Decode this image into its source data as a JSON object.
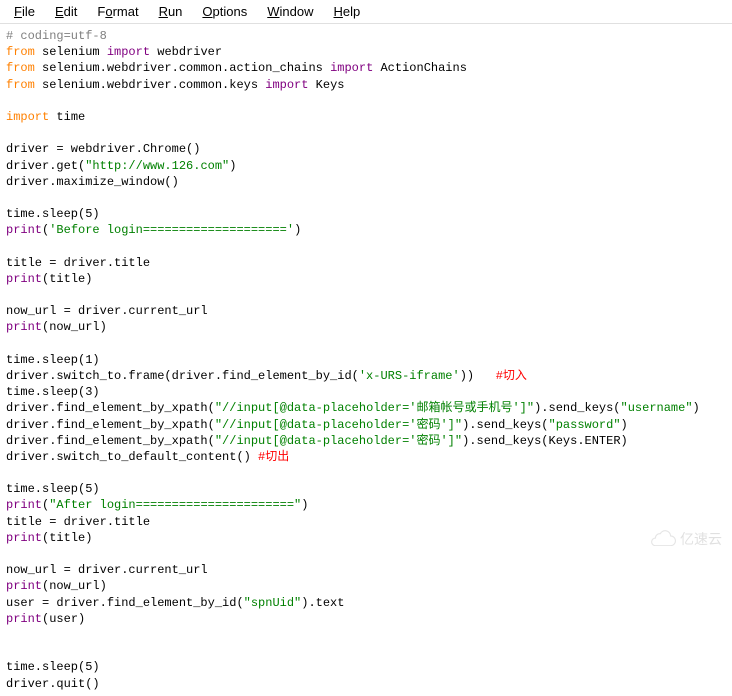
{
  "menu": {
    "file": "File",
    "edit": "Edit",
    "format": "Format",
    "run": "Run",
    "options": "Options",
    "window": "Window",
    "help": "Help"
  },
  "code": {
    "l1_comment": "# coding=utf-8",
    "l2_from": "from",
    "l2_mod": " selenium ",
    "l2_import": "import",
    "l2_item": " webdriver",
    "l3_from": "from",
    "l3_mod": " selenium.webdriver.common.action_chains ",
    "l3_import": "import",
    "l3_item": " ActionChains",
    "l4_from": "from",
    "l4_mod": " selenium.webdriver.common.keys ",
    "l4_import": "import",
    "l4_item": " Keys",
    "l6_import": "import",
    "l6_item": " time",
    "l8": "driver = webdriver.Chrome()",
    "l9a": "driver.get(",
    "l9s": "\"http://www.126.com\"",
    "l9b": ")",
    "l10": "driver.maximize_window()",
    "l12": "time.sleep(5)",
    "l13p": "print",
    "l13a": "(",
    "l13s": "'Before login===================='",
    "l13b": ")",
    "l15": "title = driver.title",
    "l16p": "print",
    "l16a": "(title)",
    "l18": "now_url = driver.current_url",
    "l19p": "print",
    "l19a": "(now_url)",
    "l21": "time.sleep(1)",
    "l22a": "driver.switch_to.frame(driver.find_element_by_id(",
    "l22s": "'x-URS-iframe'",
    "l22b": "))   ",
    "l22c": "#切入",
    "l23": "time.sleep(3)",
    "l24a": "driver.find_element_by_xpath(",
    "l24s": "\"//input[@data-placeholder='邮箱帐号或手机号']\"",
    "l24b": ").send_keys(",
    "l24s2": "\"username\"",
    "l24c": ")",
    "l25a": "driver.find_element_by_xpath(",
    "l25s": "\"//input[@data-placeholder='密码']\"",
    "l25b": ").send_keys(",
    "l25s2": "\"password\"",
    "l25c": ")",
    "l26a": "driver.find_element_by_xpath(",
    "l26s": "\"//input[@data-placeholder='密码']\"",
    "l26b": ").send_keys(Keys.ENTER)",
    "l27a": "driver.switch_to_default_content() ",
    "l27c": "#切出",
    "l29": "time.sleep(5)",
    "l30p": "print",
    "l30a": "(",
    "l30s": "\"After login======================\"",
    "l30b": ")",
    "l31": "title = driver.title",
    "l32p": "print",
    "l32a": "(title)",
    "l34": "now_url = driver.current_url",
    "l35p": "print",
    "l35a": "(now_url)",
    "l36a": "user = driver.find_element_by_id(",
    "l36s": "\"spnUid\"",
    "l36b": ").text",
    "l37p": "print",
    "l37a": "(user)",
    "l40": "time.sleep(5)",
    "l41": "driver.quit()"
  },
  "watermark": {
    "text": "亿速云"
  }
}
